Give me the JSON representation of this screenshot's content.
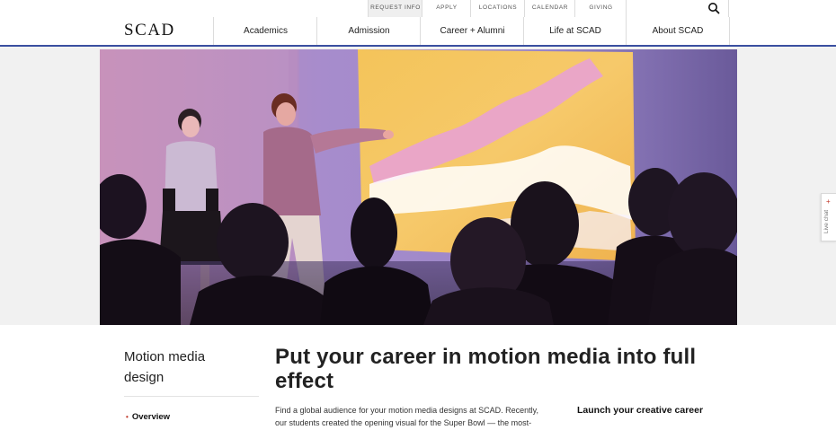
{
  "utility_nav": {
    "request_info": "REQUEST INFO",
    "apply": "APPLY",
    "locations": "LOCATIONS",
    "calendar": "CALENDAR",
    "giving": "GIVING"
  },
  "header": {
    "logo": "SCAD",
    "nav": [
      "Academics",
      "Admission",
      "Career + Alumni",
      "Life at SCAD",
      "About SCAD"
    ]
  },
  "live_chat": {
    "label": "Live chat",
    "icon": "+"
  },
  "sidebar": {
    "title_line1": "Motion media",
    "title_line2": "design",
    "items": [
      {
        "label": "Overview",
        "bullet": "•"
      }
    ]
  },
  "main": {
    "heading_line1": "Put your career in motion media into full",
    "heading_line2": "effect",
    "body_line1": "Find a global audience for your motion media designs at SCAD. Recently,",
    "body_line2": "our students created the opening visual for the Super Bowl — the most-"
  },
  "aside": {
    "heading": "Launch your creative career"
  },
  "colors": {
    "accent_border": "#3a4fa0",
    "bullet": "#c0392b"
  }
}
